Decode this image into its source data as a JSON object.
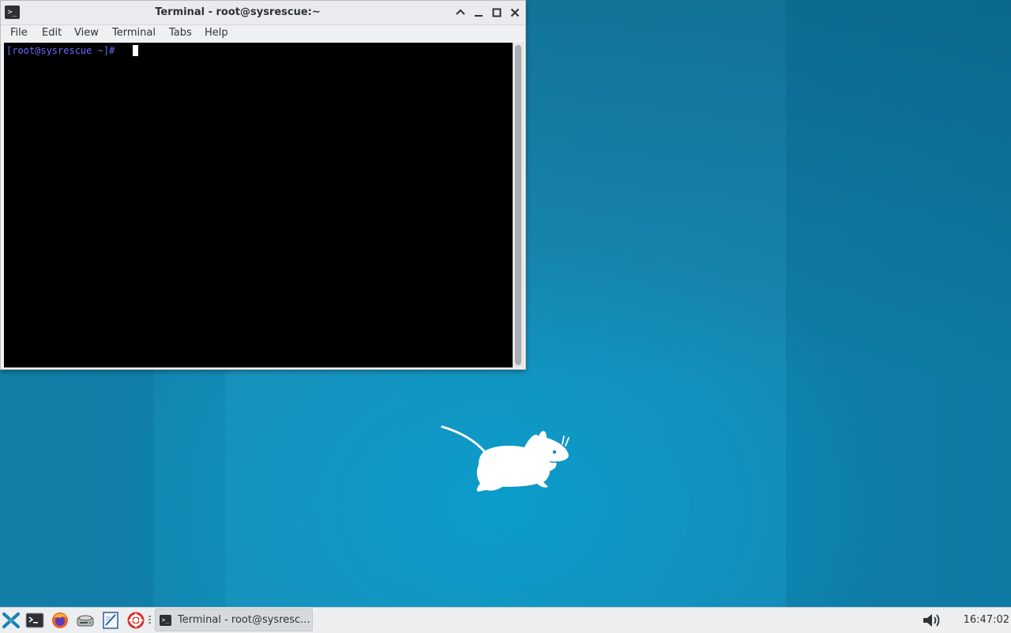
{
  "window": {
    "title": "Terminal - root@sysrescue:~",
    "menu": [
      "File",
      "Edit",
      "View",
      "Terminal",
      "Tabs",
      "Help"
    ],
    "prompt": "[root@sysrescue ~]#"
  },
  "taskbar": {
    "launchers": [
      "xfce-menu-icon",
      "terminal-icon",
      "firefox-icon",
      "disk-icon",
      "text-editor-icon",
      "help-lifebuoy-icon"
    ],
    "task_label": "Terminal - root@sysresc...",
    "clock": "16:47:02"
  },
  "colors": {
    "desktop": "#1789b4",
    "prompt": "#6a6aff",
    "terminal_bg": "#000000"
  }
}
